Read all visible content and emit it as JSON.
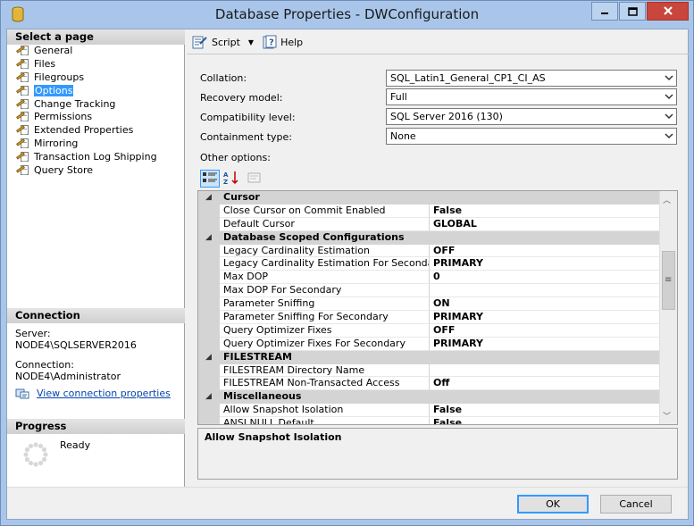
{
  "window": {
    "title": "Database Properties - DWConfiguration"
  },
  "left_pane": {
    "select_page_header": "Select a page",
    "pages": [
      {
        "label": "General",
        "selected": false
      },
      {
        "label": "Files",
        "selected": false
      },
      {
        "label": "Filegroups",
        "selected": false
      },
      {
        "label": "Options",
        "selected": true
      },
      {
        "label": "Change Tracking",
        "selected": false
      },
      {
        "label": "Permissions",
        "selected": false
      },
      {
        "label": "Extended Properties",
        "selected": false
      },
      {
        "label": "Mirroring",
        "selected": false
      },
      {
        "label": "Transaction Log Shipping",
        "selected": false
      },
      {
        "label": "Query Store",
        "selected": false
      }
    ],
    "connection_header": "Connection",
    "server_label": "Server:",
    "server_value": "NODE4\\SQLSERVER2016",
    "connection_label": "Connection:",
    "connection_value": "NODE4\\Administrator",
    "view_connection_link": "View connection properties",
    "progress_header": "Progress",
    "progress_status": "Ready"
  },
  "toolbar": {
    "script_label": "Script",
    "help_label": "Help"
  },
  "options": {
    "collation_label": "Collation:",
    "collation_value": "SQL_Latin1_General_CP1_CI_AS",
    "recovery_label": "Recovery model:",
    "recovery_value": "Full",
    "compat_label": "Compatibility level:",
    "compat_value": "SQL Server 2016 (130)",
    "containment_label": "Containment type:",
    "containment_value": "None",
    "other_options_label": "Other options:"
  },
  "property_grid": [
    {
      "type": "category",
      "label": "Cursor"
    },
    {
      "type": "prop",
      "label": "Close Cursor on Commit Enabled",
      "value": "False"
    },
    {
      "type": "prop",
      "label": "Default Cursor",
      "value": "GLOBAL"
    },
    {
      "type": "category",
      "label": "Database Scoped Configurations"
    },
    {
      "type": "prop",
      "label": "Legacy Cardinality Estimation",
      "value": "OFF"
    },
    {
      "type": "prop",
      "label": "Legacy Cardinality Estimation For Secondary",
      "value": "PRIMARY"
    },
    {
      "type": "prop",
      "label": "Max DOP",
      "value": "0"
    },
    {
      "type": "prop",
      "label": "Max DOP For Secondary",
      "value": ""
    },
    {
      "type": "prop",
      "label": "Parameter Sniffing",
      "value": "ON"
    },
    {
      "type": "prop",
      "label": "Parameter Sniffing For Secondary",
      "value": "PRIMARY"
    },
    {
      "type": "prop",
      "label": "Query Optimizer Fixes",
      "value": "OFF"
    },
    {
      "type": "prop",
      "label": "Query Optimizer Fixes For Secondary",
      "value": "PRIMARY"
    },
    {
      "type": "category",
      "label": "FILESTREAM"
    },
    {
      "type": "prop",
      "label": "FILESTREAM Directory Name",
      "value": ""
    },
    {
      "type": "prop",
      "label": "FILESTREAM Non-Transacted Access",
      "value": "Off"
    },
    {
      "type": "category",
      "label": "Miscellaneous"
    },
    {
      "type": "prop",
      "label": "Allow Snapshot Isolation",
      "value": "False"
    },
    {
      "type": "prop",
      "label": "ANSI NULL Default",
      "value": "False"
    }
  ],
  "description": {
    "title": "Allow Snapshot Isolation"
  },
  "buttons": {
    "ok_label": "OK",
    "cancel_label": "Cancel"
  },
  "colors": {
    "title_bar": "#a9c6ea",
    "selection": "#3399ff",
    "close_button": "#c9463d",
    "link": "#0645ad"
  }
}
